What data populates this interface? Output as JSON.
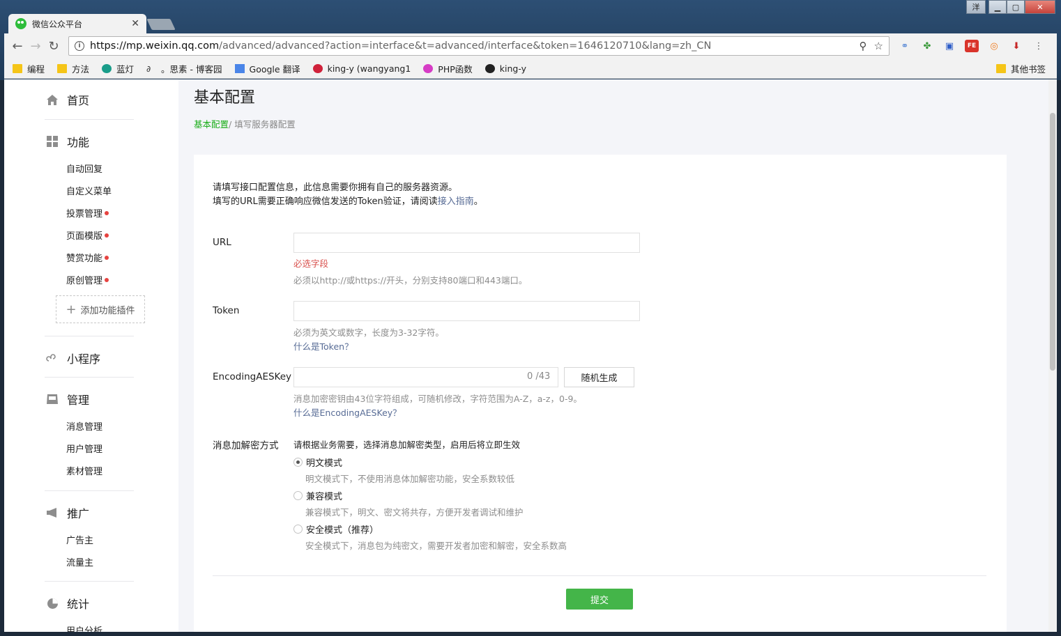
{
  "window": {
    "user_label": "洋",
    "minimize": "▁",
    "maximize": "▢",
    "close": "✕"
  },
  "tab": {
    "title": "微信公众平台",
    "close": "✕",
    "favicon": "wechat-icon"
  },
  "toolbar": {
    "back": "←",
    "forward": "→",
    "reload": "↻",
    "url_host": "https://mp.weixin.qq.com",
    "url_path": "/advanced/advanced?action=interface&t=advanced/interface&token=1646120710&lang=zh_CN",
    "zoom_icon": "⚲",
    "star_icon": "☆",
    "menu_icon": "⋮"
  },
  "bookmarks": {
    "items": [
      "编程",
      "方法",
      "蓝灯",
      "。思素 - 博客园",
      "Google 翻译",
      "king-y (wangyang1",
      "PHP函数",
      "king-y"
    ],
    "other": "其他书签"
  },
  "sidebar": {
    "home": "首页",
    "features": "功能",
    "features_items": [
      "自动回复",
      "自定义菜单",
      "投票管理",
      "页面模版",
      "赞赏功能",
      "原创管理"
    ],
    "add_plugin": "添加功能插件",
    "miniprogram": "小程序",
    "management": "管理",
    "management_items": [
      "消息管理",
      "用户管理",
      "素材管理"
    ],
    "promotion": "推广",
    "promotion_items": [
      "广告主",
      "流量主"
    ],
    "stats": "统计",
    "stats_items": [
      "用户分析"
    ]
  },
  "main": {
    "title": "基本配置",
    "breadcrumb_link": "基本配置",
    "breadcrumb_current": "/ 填写服务器配置",
    "intro_line1": "请填写接口配置信息，此信息需要你拥有自己的服务器资源。",
    "intro_line2_prefix": "填写的URL需要正确响应微信发送的Token验证，请阅读",
    "intro_line2_link": "接入指南",
    "intro_line2_suffix": "。",
    "url_label": "URL",
    "url_value": "",
    "url_error": "必选字段",
    "url_tip": "必须以http://或https://开头，分别支持80端口和443端口。",
    "token_label": "Token",
    "token_value": "",
    "token_tip": "必须为英文或数字，长度为3-32字符。",
    "token_link": "什么是Token？",
    "aes_label": "EncodingAESKey",
    "aes_value": "",
    "aes_counter": "0 /43",
    "aes_random": "随机生成",
    "aes_tip": "消息加密密钥由43位字符组成，可随机修改，字符范围为A-Z，a-z，0-9。",
    "aes_link": "什么是EncodingAESKey？",
    "mode_label": "消息加解密方式",
    "mode_intro": "请根据业务需要，选择消息加解密类型，启用后将立即生效",
    "modes": [
      {
        "name": "明文模式",
        "desc": "明文模式下，不使用消息体加解密功能，安全系数较低",
        "checked": true
      },
      {
        "name": "兼容模式",
        "desc": "兼容模式下，明文、密文将共存，方便开发者调试和维护",
        "checked": false
      },
      {
        "name": "安全模式（推荐）",
        "desc": "安全模式下，消息包为纯密文，需要开发者加密和解密，安全系数高",
        "checked": false
      }
    ],
    "submit": "提交"
  },
  "colors": {
    "accent_green": "#44b549",
    "link_blue": "#576b95",
    "error_red": "#d9534f",
    "dot_red": "#e64340"
  }
}
